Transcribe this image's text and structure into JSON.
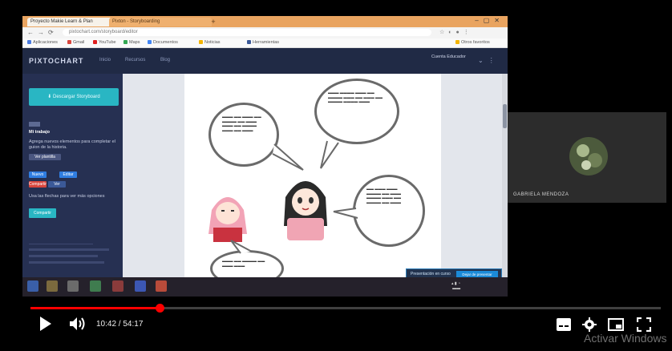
{
  "browser": {
    "tab_active": "Proyecto Makie Learn & Plan",
    "tab_second": "Pixton - Storyboarding",
    "url": "pixtochart.com/storyboard/editor",
    "bookmarks": [
      "Aplicaciones",
      "Gmail",
      "YouTube",
      "Maps",
      "Documentos",
      "Noticias",
      "Herramientas",
      "Otros favoritos"
    ]
  },
  "app": {
    "logo": "PIXTOCHART",
    "nav": [
      "Inicio",
      "Recursos",
      "Blog"
    ],
    "user_menu": "Cuenta Educador",
    "download_label": "Descargar Storyboard",
    "side_heading": "Mi trabajo",
    "side_desc": "Agrega nuevos elementos para completar el guion de la historia.",
    "side_button": "Ver plantilla",
    "tags": [
      "Nuevo",
      "Editar",
      "Compartir",
      "Ver"
    ],
    "side_tip": "Usa las flechas para ver más opciones",
    "side_action": "Compartir",
    "toast_text": "Presentación en curso",
    "toast_button": "Dejar de presentar"
  },
  "participant": {
    "name": "GABRIELA MENDOZA"
  },
  "player": {
    "time_current": "10:42",
    "time_total": "54:17",
    "progress_fraction": 0.205
  },
  "watermark": "Activar Windows"
}
